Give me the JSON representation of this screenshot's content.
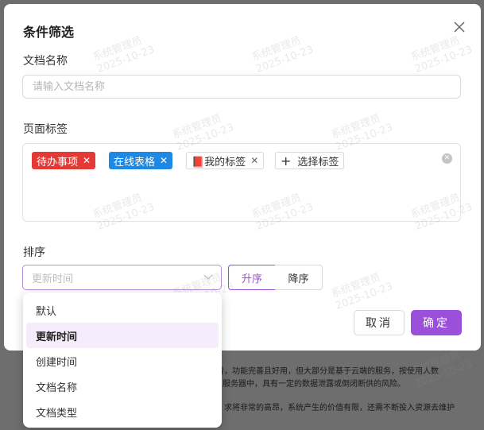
{
  "background_text": {
    "line1": "看，功能完善且好用，但大部分是基于云端的服务，按使用人数",
    "line2": "服务器中，具有一定的数据泄露或倒闭断供的风险。",
    "line3": "求将非常的高昂，系统产生的价值有限，还需不断投入资源去维护"
  },
  "modal": {
    "title": "条件筛选",
    "doc_name": {
      "label": "文档名称",
      "placeholder": "请输入文档名称",
      "value": ""
    },
    "page_tags": {
      "label": "页面标签",
      "tags": [
        {
          "label": "待办事项",
          "color": "#e53935"
        },
        {
          "label": "在线表格",
          "color": "#1e88e5"
        },
        {
          "label": "📕我的标签",
          "color": "#ffffff"
        }
      ],
      "select_button": "选择标签"
    },
    "sort": {
      "label": "排序",
      "select_placeholder": "更新时间",
      "asc": "升序",
      "desc": "降序",
      "selected_order": "升序"
    },
    "cancel": "取消",
    "confirm": "确定"
  },
  "dropdown": {
    "options": [
      "默认",
      "更新时间",
      "创建时间",
      "文档名称",
      "文档类型"
    ],
    "selected": "更新时间"
  },
  "watermark": {
    "user": "系统管理员",
    "date": "2025-10-23"
  },
  "colors": {
    "accent": "#9c4fd8",
    "tag_red": "#e53935",
    "tag_blue": "#1e88e5"
  }
}
